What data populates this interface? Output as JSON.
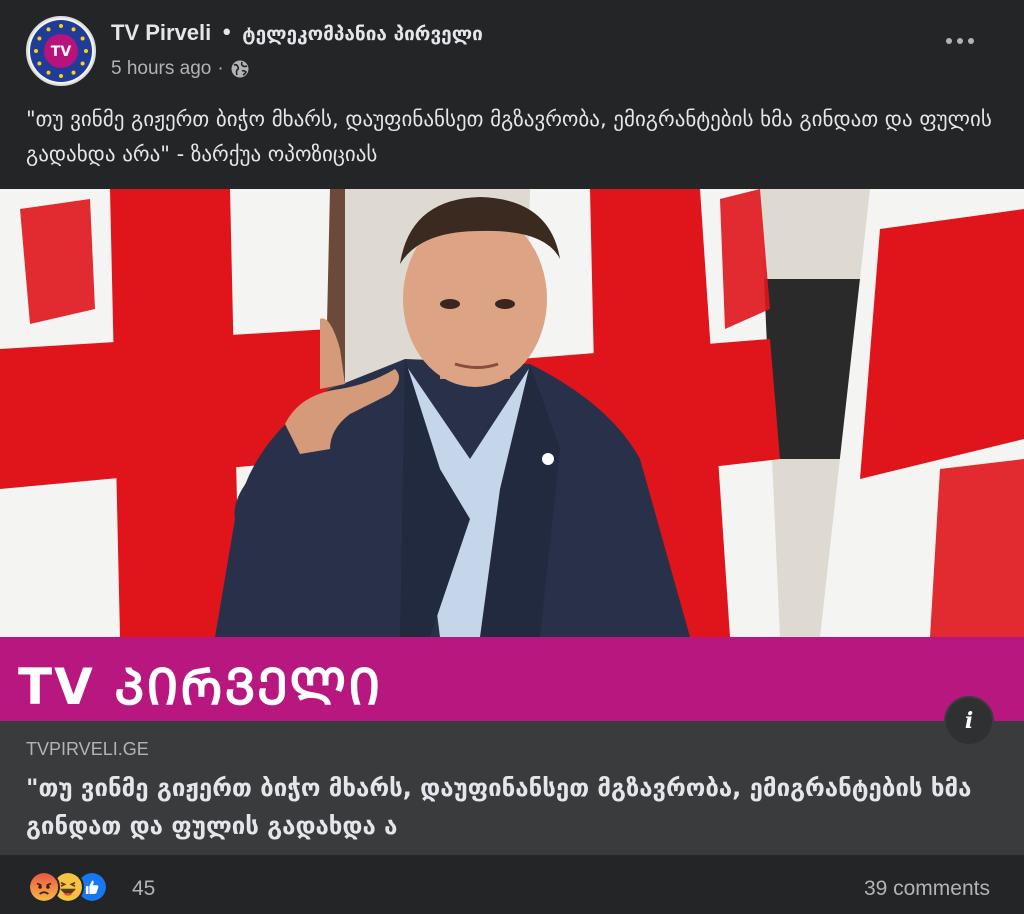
{
  "header": {
    "page_name": "TV Pirveli",
    "separator": "•",
    "page_subname": "ტელეკომპანია პირველი",
    "timestamp": "5 hours ago",
    "meta_sep": "·",
    "privacy_icon": "globe-icon",
    "more_icon": "more-options-icon",
    "avatar_text": "TV"
  },
  "post": {
    "caption": "\"თუ ვინმე გიჟერთ ბიჭო მხარს, დაუფინანსეთ მგზავრობა, ემიგრანტების ხმა გინდათ და ფულის გადახდა არა\" - ზარქუა ოპოზიციას"
  },
  "media": {
    "banner_text": "TV ᲞᲘᲠᲕᲔᲚᲘ",
    "info_icon": "info-icon",
    "info_label": "i",
    "colors": {
      "flag_red": "#e0151c",
      "flag_white": "#f4f4f2",
      "banner": "#b7177f"
    }
  },
  "link_preview": {
    "domain": "TVPIRVELI.GE",
    "title": "\"თუ ვინმე გიჟერთ ბიჭო მხარს, დაუფინანსეთ მგზავრობა, ემიგრანტების ხმა გინდათ და ფულის გადახდა ა"
  },
  "footer": {
    "reactions": [
      "angry-icon",
      "haha-icon",
      "like-icon"
    ],
    "reaction_count": "45",
    "comments": "39 comments"
  }
}
